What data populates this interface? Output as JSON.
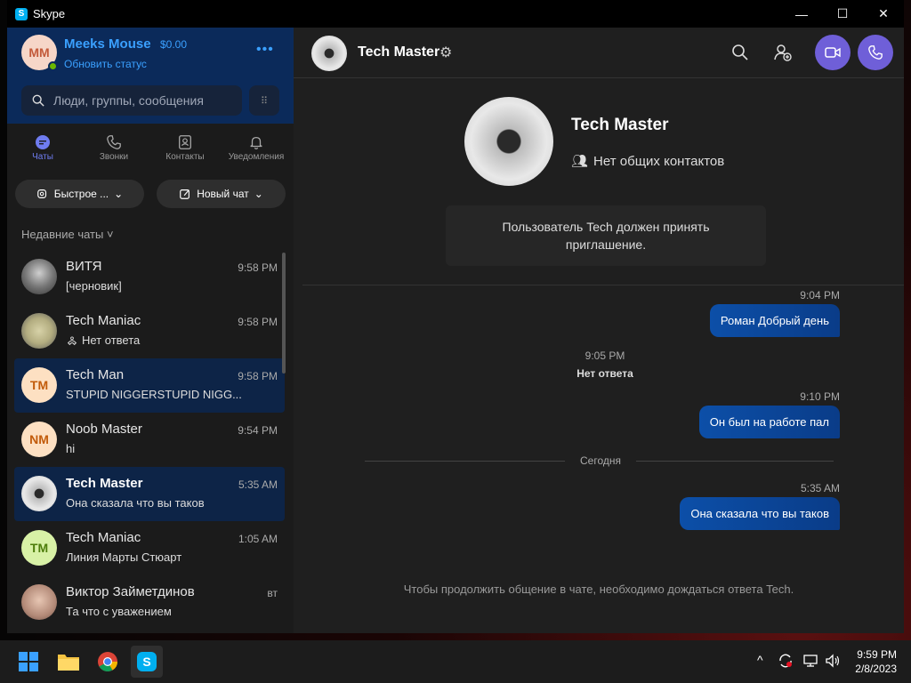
{
  "window": {
    "title": "Skype",
    "minimize": "—",
    "maximize": "☐",
    "close": "✕"
  },
  "profile": {
    "initials": "MM",
    "name": "Meeks Mouse",
    "balance": "$0.00",
    "status_link": "Обновить статус",
    "more": "•••"
  },
  "search": {
    "placeholder": "Люди, группы, сообщения",
    "dialpad": "⠿"
  },
  "nav": [
    {
      "label": "Чаты",
      "icon": "chat-icon"
    },
    {
      "label": "Звонки",
      "icon": "phone-icon"
    },
    {
      "label": "Контакты",
      "icon": "contacts-icon"
    },
    {
      "label": "Уведомления",
      "icon": "bell-icon"
    }
  ],
  "actions": {
    "quick": "Быстрое ...",
    "new_chat": "Новый чат"
  },
  "recent_header": "Недавние чаты ˅",
  "chats": [
    {
      "name": "ВИТЯ",
      "time": "9:58 PM",
      "message": "[черновик]",
      "initials": ""
    },
    {
      "name": "Tech Maniac",
      "time": "9:58 PM",
      "message": "Нет ответа",
      "initials": ""
    },
    {
      "name": "Tech Man",
      "time": "9:58 PM",
      "message": "STUPID NIGGERSTUPID NIGG...",
      "initials": "TM"
    },
    {
      "name": "Noob Master",
      "time": "9:54 PM",
      "message": "hi",
      "initials": "NM"
    },
    {
      "name": "Tech Master",
      "time": "5:35 AM",
      "message": "Она сказала что вы таков",
      "initials": ""
    },
    {
      "name": "Tech Maniac",
      "time": "1:05 AM",
      "message": "Линия Марты Стюарт",
      "initials": "TM"
    },
    {
      "name": "Виктор Займетдинов",
      "time": "вт",
      "message": "Та что с уважением",
      "initials": ""
    }
  ],
  "conversation": {
    "name": "Tech Master",
    "contacts_text": "Нет общих контактов",
    "invite_text": "Пользователь Tech должен принять приглашение.",
    "messages": [
      {
        "time": "9:04 PM",
        "text": "Роман Добрый день"
      },
      {
        "time": "9:10 PM",
        "text": "Он был на работе пал"
      },
      {
        "time": "5:35 AM",
        "text": "Она сказала что вы таков"
      }
    ],
    "system": {
      "time": "9:05 PM",
      "text": "Нет ответа"
    },
    "day_separator": "Сегодня",
    "bottom_note": "Чтобы продолжить общение в чате, необходимо дождаться ответа Tech."
  },
  "taskbar": {
    "time": "9:59 PM",
    "date": "2/8/2023",
    "chevron": "^"
  },
  "colors": {
    "accent": "#6f5fd8",
    "bubble": "#0c4fa8",
    "link": "#3aa0ff"
  }
}
